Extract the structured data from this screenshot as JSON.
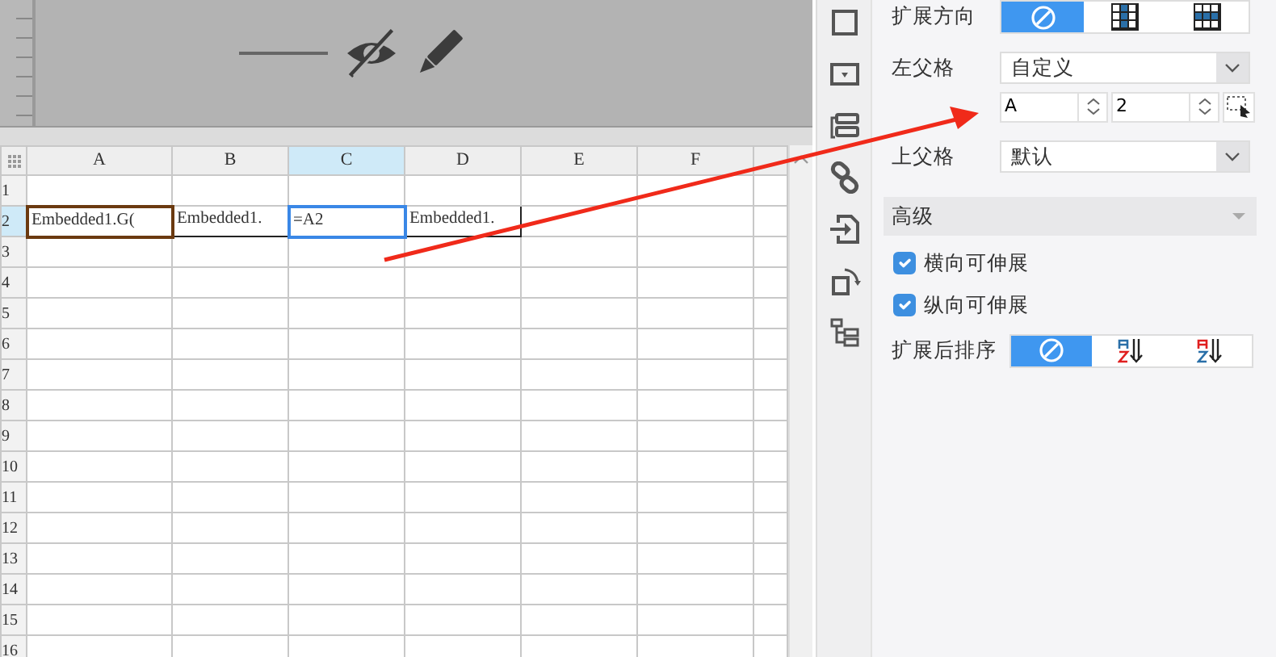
{
  "sheet": {
    "columns": [
      {
        "label": "A",
        "selected": false
      },
      {
        "label": "B",
        "selected": false
      },
      {
        "label": "C",
        "selected": true
      },
      {
        "label": "D",
        "selected": false
      },
      {
        "label": "E",
        "selected": false
      },
      {
        "label": "F",
        "selected": false
      }
    ],
    "rows": [
      {
        "label": "1",
        "selected": false
      },
      {
        "label": "2",
        "selected": true,
        "cells": [
          {
            "text": "Embedded1.G(",
            "selected": false
          },
          {
            "text": "Embedded1.",
            "selected": false
          },
          {
            "text": "=A2",
            "selected": true
          },
          {
            "text": "Embedded1.",
            "selected": false
          }
        ]
      },
      {
        "label": "3",
        "selected": false
      },
      {
        "label": "4",
        "selected": false
      },
      {
        "label": "5",
        "selected": false
      },
      {
        "label": "6",
        "selected": false
      },
      {
        "label": "7",
        "selected": false
      },
      {
        "label": "8",
        "selected": false
      },
      {
        "label": "9",
        "selected": false
      },
      {
        "label": "10",
        "selected": false
      },
      {
        "label": "11",
        "selected": false
      },
      {
        "label": "12",
        "selected": false
      },
      {
        "label": "13",
        "selected": false
      },
      {
        "label": "14",
        "selected": false
      },
      {
        "label": "15",
        "selected": false
      },
      {
        "label": "16",
        "selected": false
      }
    ]
  },
  "properties": {
    "expand_direction": {
      "label": "扩展方向",
      "options": [
        {
          "kind": "none",
          "selected": true
        },
        {
          "kind": "vertical",
          "selected": false
        },
        {
          "kind": "horizontal",
          "selected": false
        }
      ]
    },
    "left_parent": {
      "label": "左父格",
      "value": "自定义",
      "column": "A",
      "row": "2"
    },
    "top_parent": {
      "label": "上父格",
      "value": "默认"
    },
    "advanced": {
      "title": "高级",
      "expanded": true
    },
    "checkboxes": [
      {
        "label": "横向可伸展",
        "checked": true
      },
      {
        "label": "纵向可伸展",
        "checked": true
      }
    ],
    "sort": {
      "label": "扩展后排序",
      "options": [
        {
          "kind": "none",
          "selected": true
        },
        {
          "kind": "ascending",
          "selected": false
        },
        {
          "kind": "descending",
          "selected": false
        }
      ]
    }
  }
}
